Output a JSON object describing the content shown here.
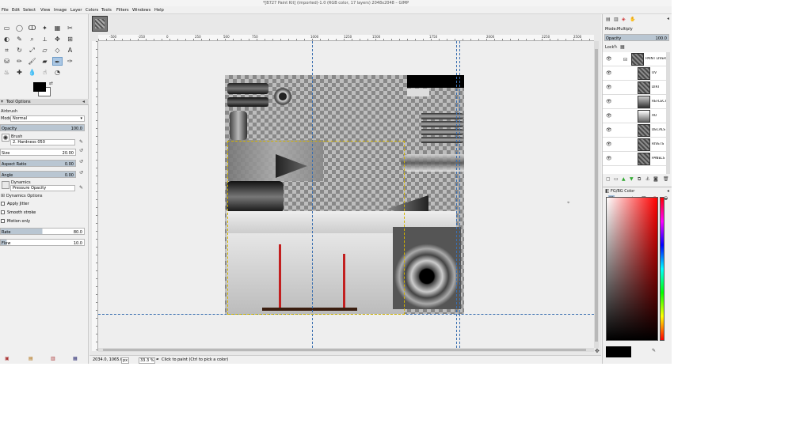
{
  "window": {
    "title": "*[B727 Paint Kit] (imported)-1.0 (RGB color, 17 layers) 2048x2048 – GIMP"
  },
  "menu": [
    "File",
    "Edit",
    "Select",
    "View",
    "Image",
    "Layer",
    "Colors",
    "Tools",
    "Filters",
    "Windows",
    "Help"
  ],
  "tool_options": {
    "tab": "Tool Options",
    "tool_name": "Airbrush",
    "mode_label": "Mode:",
    "mode_value": "Normal",
    "opacity_label": "Opacity",
    "opacity_value": "100.0",
    "brush_label": "Brush",
    "brush_value": "2. Hardness 050",
    "size_label": "Size",
    "size_value": "20.00",
    "aspect_label": "Aspect Ratio",
    "aspect_value": "0.00",
    "angle_label": "Angle",
    "angle_value": "0.00",
    "dynamics_label": "Dynamics",
    "dynamics_value": "Pressure Opacity",
    "dynamics_options": "Dynamics Options",
    "apply_jitter": "Apply Jitter",
    "smooth_stroke": "Smooth stroke",
    "motion_only": "Motion only",
    "rate_label": "Rate",
    "rate_value": "80.0",
    "flow_label": "Flow",
    "flow_value": "10.0"
  },
  "ruler": {
    "ticks": [
      "-500",
      "-250",
      "0",
      "250",
      "500",
      "750",
      "1000",
      "1250",
      "1500",
      "1750",
      "2000",
      "2250",
      "2500"
    ]
  },
  "status": {
    "coords": "2034.0, 1065.0",
    "unit": "px",
    "zoom": "33.3 %",
    "message": "Click to paint (Ctrl to pick a color)"
  },
  "layers_panel": {
    "mode_label": "Mode:",
    "mode_value": "Multiply",
    "opacity_label": "Opacity",
    "opacity_value": "100.0",
    "lock_label": "Lock:",
    "layers": [
      {
        "name": "PAINT LIVERY"
      },
      {
        "name": "UV"
      },
      {
        "name": "DIRT"
      },
      {
        "name": "REFLECTIONS"
      },
      {
        "name": "AO"
      },
      {
        "name": "DECALS"
      },
      {
        "name": "RIVETS"
      },
      {
        "name": "PANELS"
      }
    ]
  },
  "color_panel": {
    "title": "FG/BG Color",
    "fg_color": "#000000"
  }
}
